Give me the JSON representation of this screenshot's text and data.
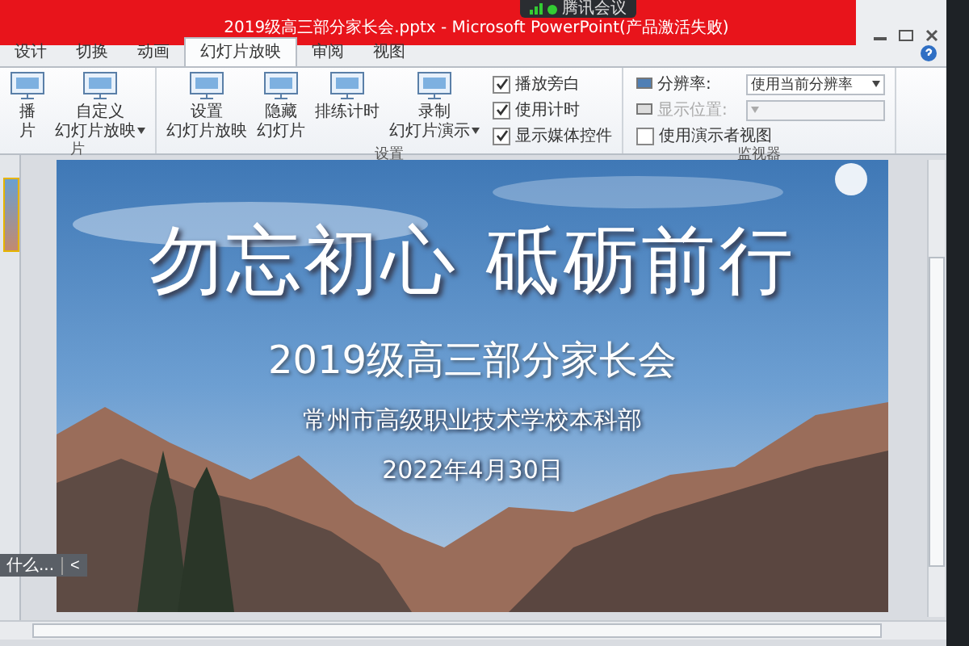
{
  "window": {
    "title": "2019级高三部分家长会.pptx - Microsoft PowerPoint(产品激活失败)",
    "overlay_title": "腾讯会议"
  },
  "tabs": [
    {
      "label": "设计",
      "selected": false
    },
    {
      "label": "切换",
      "selected": false
    },
    {
      "label": "动画",
      "selected": false
    },
    {
      "label": "幻灯片放映",
      "selected": true
    },
    {
      "label": "审阅",
      "selected": false
    },
    {
      "label": "视图",
      "selected": false
    }
  ],
  "ribbon_groups": [
    {
      "label": "片",
      "items": [
        {
          "kind": "button",
          "line1": "播",
          "line2": "片",
          "dropdown": false
        },
        {
          "kind": "button",
          "line1": "自定义",
          "line2": "幻灯片放映",
          "dropdown": true
        }
      ]
    },
    {
      "label": "设置",
      "items": [
        {
          "kind": "button",
          "line1": "设置",
          "line2": "幻灯片放映",
          "dropdown": false
        },
        {
          "kind": "button",
          "line1": "隐藏",
          "line2": "幻灯片",
          "dropdown": false
        },
        {
          "kind": "button",
          "line1": "排练计时",
          "dropdown": false
        },
        {
          "kind": "button",
          "line1": "录制",
          "line2": "幻灯片演示",
          "dropdown": true
        },
        {
          "kind": "checkbox",
          "label": "播放旁白",
          "checked": true
        },
        {
          "kind": "checkbox",
          "label": "使用计时",
          "checked": true
        },
        {
          "kind": "checkbox",
          "label": "显示媒体控件",
          "checked": true
        }
      ]
    },
    {
      "label": "监视器",
      "items": [
        {
          "kind": "select",
          "label": "分辨率:",
          "value": "使用当前分辨率",
          "disabled": false
        },
        {
          "kind": "select",
          "label": "显示位置:",
          "disabled": true
        },
        {
          "kind": "checkbox",
          "label": "使用演示者视图",
          "checked": false
        }
      ]
    }
  ],
  "slide": {
    "title": "勿忘初心 砥砺前行",
    "subtitle": "2019级高三部分家长会",
    "organization": "常州市高级职业技术学校本科部",
    "date": "2022年4月30日"
  },
  "side_popup": {
    "label": "什么...",
    "button": "<"
  }
}
